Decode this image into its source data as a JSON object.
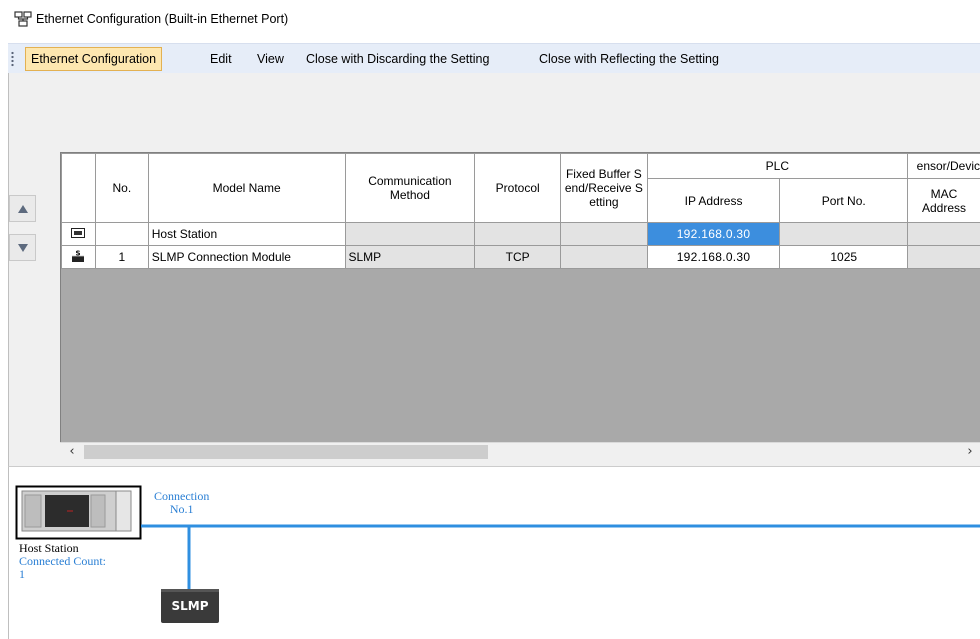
{
  "window": {
    "title": "Ethernet Configuration (Built-in Ethernet Port)"
  },
  "menu": {
    "items": [
      "Ethernet Configuration",
      "Edit",
      "View",
      "Close with Discarding the Setting",
      "Close with Reflecting the Setting"
    ],
    "active_index": 0
  },
  "grid": {
    "headers": {
      "no": "No.",
      "model_name": "Model Name",
      "communication_method": "Communication Method",
      "protocol": "Protocol",
      "fixed_buffer": "Fixed Buffer Send/Receive Setting",
      "plc_group": "PLC",
      "ip_address": "IP Address",
      "port_no": "Port No.",
      "sensor_group": "ensor/Devic",
      "mac_address": "MAC Address"
    },
    "rows": [
      {
        "icon": "host-station-icon",
        "no": "",
        "model_name": "Host Station",
        "communication_method": "",
        "protocol": "",
        "fixed_buffer": "",
        "ip_address": "192.168.0.30",
        "port_no": "",
        "mac_address": ""
      },
      {
        "icon": "slmp-module-icon",
        "no": "1",
        "model_name": "SLMP Connection Module",
        "communication_method": "SLMP",
        "protocol": "TCP",
        "fixed_buffer": "",
        "ip_address": "192.168.0.30",
        "port_no": "1025",
        "mac_address": ""
      }
    ]
  },
  "diagram": {
    "connection_label_1": "Connection",
    "connection_label_2": "No.1",
    "host_label": "Host Station",
    "connected_count_label": "Connected Count:",
    "connected_count_value": "1",
    "module_label": "SLMP",
    "colors": {
      "line": "#2f8fe0",
      "label": "#2a7fd4",
      "module_bg": "#3a3a3a"
    }
  }
}
